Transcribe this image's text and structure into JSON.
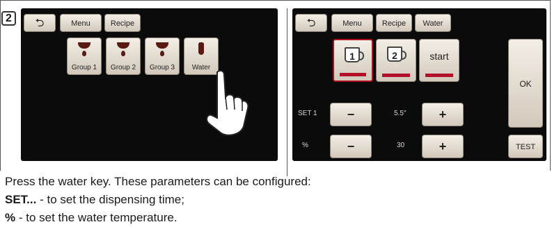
{
  "step": "2",
  "left_screen": {
    "tabs": {
      "back": "⮌",
      "menu": "Menu",
      "recipe": "Recipe"
    },
    "groups": [
      "Group 1",
      "Group 2",
      "Group 3",
      "Water"
    ]
  },
  "right_screen": {
    "tabs": {
      "back": "⮌",
      "menu": "Menu",
      "recipe": "Recipe",
      "water": "Water"
    },
    "dose1": "1",
    "dose2": "2",
    "start": "start",
    "ok": "OK",
    "test": "TEST",
    "set_label": "SET 1",
    "set_value": "5.5''",
    "pct_label": "%",
    "pct_value": "30",
    "minus": "−",
    "plus": "+"
  },
  "text": {
    "line1": "Press the water key. These parameters can be configured:",
    "line2_bold": "SET...",
    "line2_rest": " - to set the dispensing time;",
    "line3_bold": "%",
    "line3_rest": " - to set the water temperature."
  },
  "colors": {
    "screen_bg": "#0b0b0b",
    "accent": "#b3102a",
    "coffee": "#5a1a14"
  }
}
